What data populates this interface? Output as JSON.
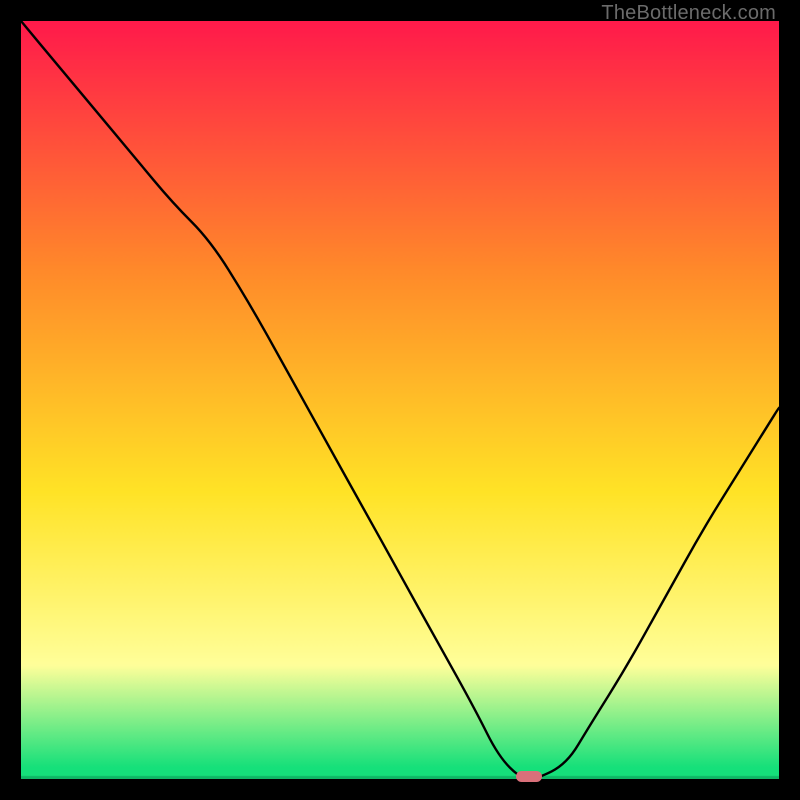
{
  "watermark": "TheBottleneck.com",
  "colors": {
    "bg": "#000000",
    "grad_top": "#ff1a4b",
    "grad_mid_orange": "#ff8a2a",
    "grad_mid_yellow": "#ffe326",
    "grad_pale_yellow": "#ffff9a",
    "grad_green": "#15e07a",
    "curve_stroke": "#000000",
    "marker_fill": "#d9707a"
  },
  "chart_data": {
    "type": "line",
    "title": "",
    "xlabel": "",
    "ylabel": "",
    "xlim": [
      0,
      100
    ],
    "ylim": [
      0,
      100
    ],
    "series": [
      {
        "name": "bottleneck-curve",
        "x": [
          0,
          5,
          10,
          15,
          20,
          25,
          30,
          35,
          40,
          45,
          50,
          55,
          60,
          63,
          66,
          68,
          72,
          75,
          80,
          85,
          90,
          95,
          100
        ],
        "y": [
          100,
          94,
          88,
          82,
          76,
          71,
          63,
          54,
          45,
          36,
          27,
          18,
          9,
          3,
          0,
          0,
          2,
          7,
          15,
          24,
          33,
          41,
          49
        ]
      }
    ],
    "marker": {
      "x": 67,
      "y": 0
    },
    "gradient_stops": [
      {
        "pos": 0.0,
        "color": "#ff1a4b"
      },
      {
        "pos": 0.33,
        "color": "#ff8a2a"
      },
      {
        "pos": 0.62,
        "color": "#ffe326"
      },
      {
        "pos": 0.85,
        "color": "#ffff9a"
      },
      {
        "pos": 0.985,
        "color": "#15e07a"
      }
    ]
  }
}
